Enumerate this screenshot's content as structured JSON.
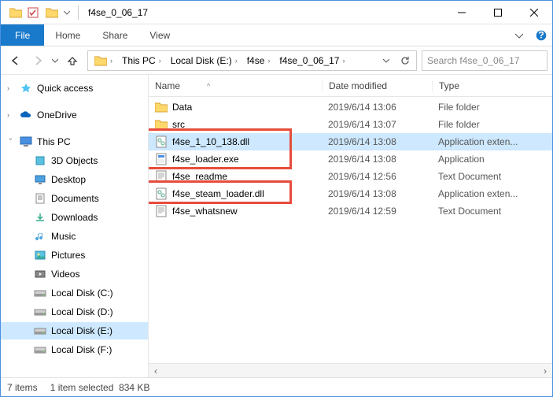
{
  "window": {
    "title": "f4se_0_06_17"
  },
  "ribbon": {
    "file": "File",
    "tabs": [
      "Home",
      "Share",
      "View"
    ]
  },
  "nav": {
    "breadcrumbs": [
      "This PC",
      "Local Disk  (E:)",
      "f4se",
      "f4se_0_06_17"
    ],
    "search_placeholder": "Search f4se_0_06_17"
  },
  "sidebar": {
    "quick_access": "Quick access",
    "onedrive": "OneDrive",
    "this_pc": "This PC",
    "children": [
      "3D Objects",
      "Desktop",
      "Documents",
      "Downloads",
      "Music",
      "Pictures",
      "Videos",
      "Local Disk  (C:)",
      "Local Disk  (D:)",
      "Local Disk  (E:)",
      "Local Disk  (F:)"
    ]
  },
  "headers": {
    "name": "Name",
    "date": "Date modified",
    "type": "Type"
  },
  "files": [
    {
      "name": "Data",
      "date": "2019/6/14 13:06",
      "type": "File folder",
      "icon": "folder"
    },
    {
      "name": "src",
      "date": "2019/6/14 13:07",
      "type": "File folder",
      "icon": "folder"
    },
    {
      "name": "f4se_1_10_138.dll",
      "date": "2019/6/14 13:08",
      "type": "Application exten...",
      "icon": "dll",
      "selected": true
    },
    {
      "name": "f4se_loader.exe",
      "date": "2019/6/14 13:08",
      "type": "Application",
      "icon": "exe"
    },
    {
      "name": "f4se_readme",
      "date": "2019/6/14 12:56",
      "type": "Text Document",
      "icon": "txt"
    },
    {
      "name": "f4se_steam_loader.dll",
      "date": "2019/6/14 13:08",
      "type": "Application exten...",
      "icon": "dll"
    },
    {
      "name": "f4se_whatsnew",
      "date": "2019/6/14 12:59",
      "type": "Text Document",
      "icon": "txt"
    }
  ],
  "status": {
    "count": "7 items",
    "selected": "1 item selected",
    "size": "834 KB"
  }
}
